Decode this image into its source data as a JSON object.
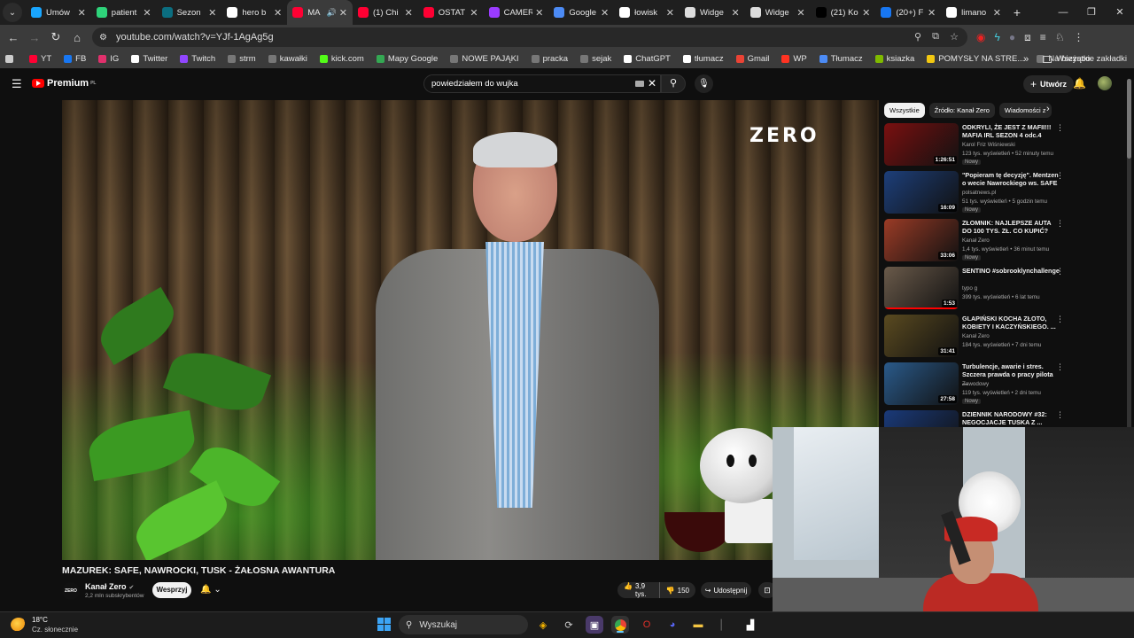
{
  "browser": {
    "tabs": [
      {
        "label": "Umów",
        "color": "#19a6ff",
        "active": false
      },
      {
        "label": "patient",
        "color": "#2ed37a",
        "active": false
      },
      {
        "label": "Sezon",
        "color": "#0b6e80",
        "active": false
      },
      {
        "label": "hero b",
        "color": "#ffffff",
        "active": false
      },
      {
        "label": "MA",
        "color": "#ff0033",
        "active": true,
        "audio": true
      },
      {
        "label": "(1) Chi",
        "color": "#ff0033",
        "active": false
      },
      {
        "label": "OSTAT",
        "color": "#ff0033",
        "active": false
      },
      {
        "label": "CAMER",
        "color": "#9b3bff",
        "active": false
      },
      {
        "label": "Google",
        "color": "#4c8bf5",
        "active": false
      },
      {
        "label": "łowisk",
        "color": "#ffffff",
        "active": false
      },
      {
        "label": "Widge",
        "color": "#dddddd",
        "active": false
      },
      {
        "label": "Widge",
        "color": "#dddddd",
        "active": false
      },
      {
        "label": "(21) Ko",
        "color": "#000000",
        "active": false
      },
      {
        "label": "(20+) F",
        "color": "#1877f2",
        "active": false
      },
      {
        "label": "limano",
        "color": "#ffffff",
        "active": false
      }
    ],
    "url": "youtube.com/watch?v=YJf-1AgAg5g",
    "bookmarks": [
      {
        "label": "",
        "color": "#cccccc"
      },
      {
        "label": "YT",
        "color": "#ff0033"
      },
      {
        "label": "FB",
        "color": "#1877f2"
      },
      {
        "label": "IG",
        "color": "#e1306c"
      },
      {
        "label": "Twitter",
        "color": "#ffffff"
      },
      {
        "label": "Twitch",
        "color": "#9146ff"
      },
      {
        "label": "strm",
        "color": "#777777"
      },
      {
        "label": "kawałki",
        "color": "#777777"
      },
      {
        "label": "kick.com",
        "color": "#53fc18"
      },
      {
        "label": "Mapy Google",
        "color": "#34a853"
      },
      {
        "label": "NOWE PAJĄKI",
        "color": "#777777"
      },
      {
        "label": "pracka",
        "color": "#777777"
      },
      {
        "label": "sejak",
        "color": "#777777"
      },
      {
        "label": "ChatGPT",
        "color": "#ffffff"
      },
      {
        "label": "tłumacz",
        "color": "#ffffff"
      },
      {
        "label": "Gmail",
        "color": "#ea4335"
      },
      {
        "label": "WP",
        "color": "#ff3322"
      },
      {
        "label": "Tłumacz",
        "color": "#4c8bf5"
      },
      {
        "label": "ksiazka",
        "color": "#7fba00"
      },
      {
        "label": "POMYSŁY NA STRE...",
        "color": "#f2c811"
      },
      {
        "label": "Na bieżąco",
        "color": "#777777"
      }
    ],
    "all_bookmarks": "Wszystkie zakładki"
  },
  "youtube": {
    "brand": "Premium",
    "region": "PL",
    "search_query": "powiedziałem do wujka",
    "create_label": "Utwórz",
    "video": {
      "overlay_logo": "ZERO",
      "title": "MAZUREK: SAFE, NAWROCKI, TUSK - ŻAŁOSNA AWANTURA",
      "channel": "Kanał Zero",
      "channel_logo": "ZERO",
      "subscribers": "2,2 mln subskrybentów",
      "support_label": "Wesprzyj",
      "likes": "3,9 tys.",
      "dislikes": "150",
      "share_label": "Udostępnij"
    },
    "chips": [
      {
        "label": "Wszystkie",
        "on": true
      },
      {
        "label": "Źródło: Kanał Zero",
        "on": false
      },
      {
        "label": "Wiadomości z",
        "on": false
      }
    ],
    "recommendations": [
      {
        "title": "ODKRYLI, ŻE JEST Z MAFII!!! MAFIA IRL SEZON 4 odc.4",
        "channel": "Karol Friz Wiśniewski",
        "meta": "123 tys. wyświetleń • 52 minuty temu",
        "badge": "Nowy",
        "duration": "1:26:51",
        "thumb": "#7a1010",
        "progress": 0
      },
      {
        "title": "\"Popieram tę decyzję\". Mentzen o wecie Nawrockiego ws. SAFE",
        "channel": "polsatnews.pl",
        "meta": "51 tys. wyświetleń • 5 godzin temu",
        "badge": "Nowy",
        "duration": "16:09",
        "thumb": "#1d3f7a",
        "progress": 0
      },
      {
        "title": "ZŁOMNIK: NAJLEPSZE AUTA DO 100 TYS. ZŁ. CO KUPIĆ?",
        "channel": "Kanał Zero",
        "meta": "1,4 tys. wyświetleń • 36 minut temu",
        "badge": "Nowy",
        "duration": "33:06",
        "thumb": "#9a3b26",
        "progress": 0
      },
      {
        "title": "SENTINO #sobrooklynchallenge",
        "channel": "typo g",
        "meta": "399 tys. wyświetleń • 6 lat temu",
        "badge": "",
        "duration": "1:53",
        "thumb": "#6a5a4a",
        "progress": 1
      },
      {
        "title": "GLAPIŃSKI KOCHA ZŁOTO, KOBIETY I KACZYŃSKIEGO. ...",
        "channel": "Kanał Zero",
        "meta": "184 tys. wyświetleń • 7 dni temu",
        "badge": "",
        "duration": "31:41",
        "thumb": "#5a4a20",
        "progress": 0
      },
      {
        "title": "Turbulencje, awarie i stres. Szczera prawda o pracy pilota ...",
        "channel": "Zawodowy",
        "meta": "119 tys. wyświetleń • 2 dni temu",
        "badge": "Nowy",
        "duration": "27:58",
        "thumb": "#2a5a8a",
        "progress": 0
      },
      {
        "title": "DZIENNIK NARODOWY #32: NEGOCJACJE TUSKA Z ...",
        "channel": "",
        "meta": "",
        "badge": "",
        "duration": "",
        "thumb": "#1a3a7a",
        "progress": 0
      }
    ]
  },
  "taskbar": {
    "temperature": "18°C",
    "weather": "Cz. słonecznie",
    "search_placeholder": "Wyszukaj"
  }
}
